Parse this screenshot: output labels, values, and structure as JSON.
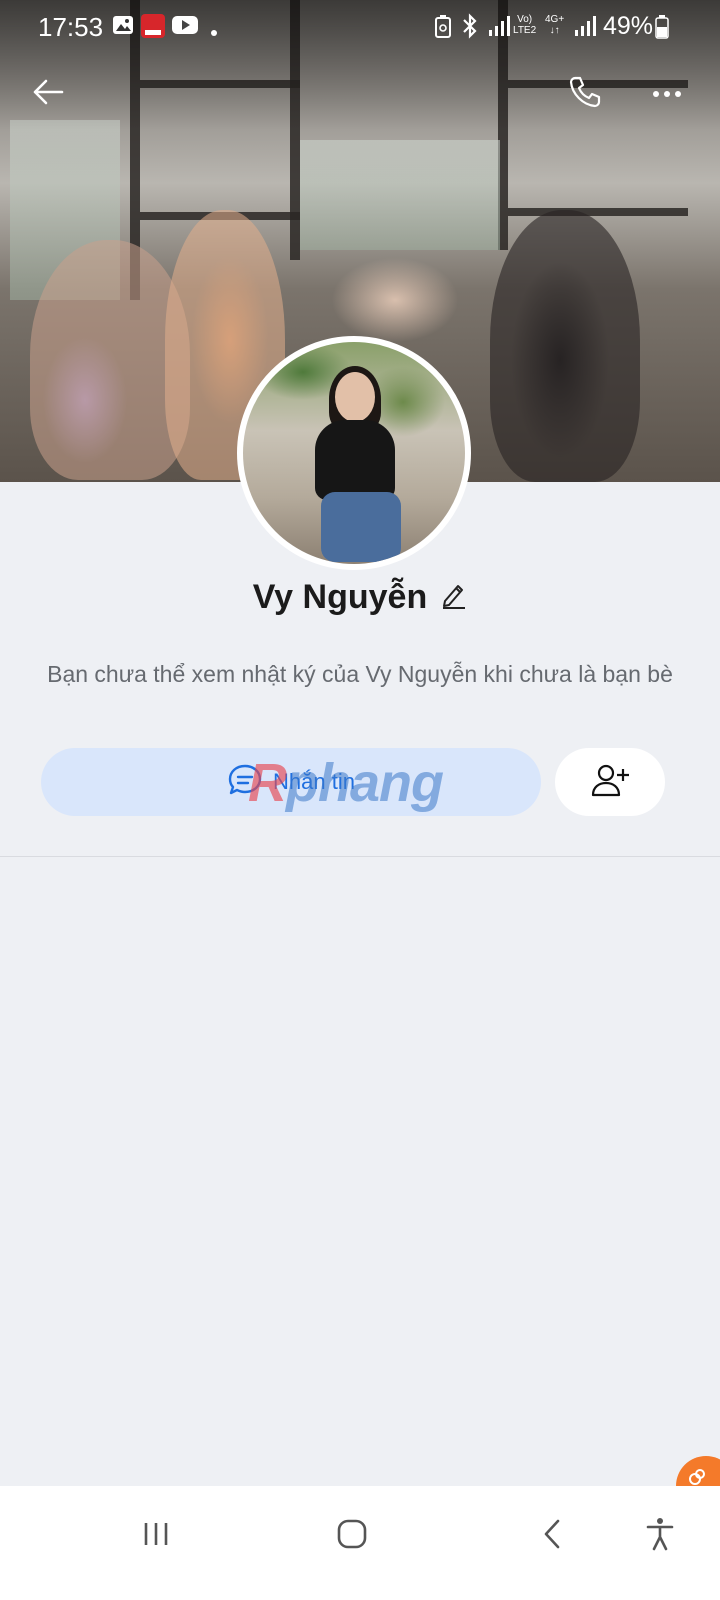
{
  "status_bar": {
    "time": "17:53",
    "battery": "49%",
    "net_top": "Vo)",
    "net_bottom": "LTE2",
    "net2_top": "4G+",
    "net2_bottom": "↓↑"
  },
  "top_bar": {
    "back_icon": "arrow-left-icon",
    "call_icon": "phone-icon",
    "more_icon": "more-horizontal-icon"
  },
  "profile": {
    "name": "Vy Nguyễn",
    "edit_icon": "pencil-icon",
    "notice": "Bạn chưa thể xem nhật ký của Vy Nguyễn khi chưa là bạn bè"
  },
  "actions": {
    "message_label": "Nhắn tin",
    "message_icon": "chat-bubble-icon",
    "add_friend_icon": "user-plus-icon"
  },
  "watermark": {
    "first": "R",
    "rest": "phang"
  },
  "colors": {
    "accent": "#1f6fe0",
    "message_button_bg": "#d9e6fb",
    "page_bg": "#eef0f4",
    "float_button": "#f47a2a"
  },
  "nav_bar": {
    "recents_icon": "recents-icon",
    "home_icon": "home-icon",
    "back_icon": "nav-back-icon",
    "accessibility_icon": "accessibility-icon"
  }
}
